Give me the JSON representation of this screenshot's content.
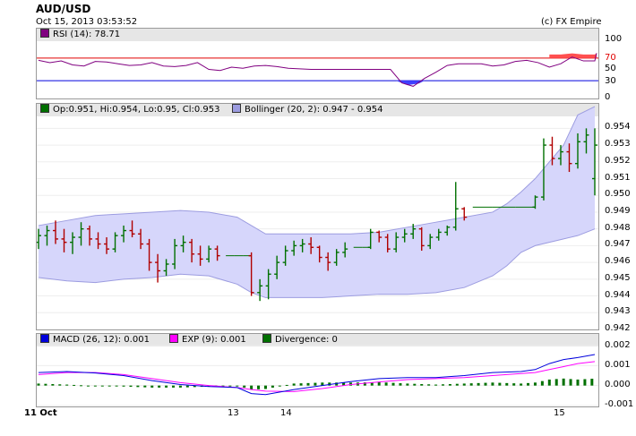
{
  "header": {
    "title": "AUD/USD",
    "timestamp": "Oct 15, 2013 03:53:52",
    "copyright": "(c) FX Empire"
  },
  "colors": {
    "bull": "#007000",
    "bear": "#b00000",
    "band_fill": "#d6d6fb",
    "band_line": "#9c9ce0",
    "rsi_line": "#800080",
    "rsi_upper": "#e00000",
    "rsi_lower": "#0000dd",
    "macd": "#0000dd",
    "exp": "#ff00ff",
    "divergence": "#007000"
  },
  "chart_data": [
    {
      "type": "line",
      "panel": "rsi",
      "legend": "RSI (14): 78.71",
      "ylim": [
        0,
        100
      ],
      "y_ticks": [
        "100",
        "70",
        "50",
        "30",
        "0"
      ],
      "levels": [
        70,
        30
      ],
      "x": [
        0,
        4,
        8,
        12,
        16,
        20,
        24,
        28,
        32,
        36,
        40,
        44,
        48,
        52,
        56,
        60,
        64,
        68,
        72,
        76,
        80,
        84,
        88,
        92,
        96,
        100,
        104,
        108,
        112,
        116,
        120,
        124,
        128,
        132,
        136,
        140,
        144,
        148,
        152,
        156,
        160,
        164,
        168,
        172,
        176,
        180,
        184,
        188,
        192,
        196
      ],
      "values": [
        66,
        62,
        65,
        58,
        56,
        64,
        63,
        60,
        57,
        58,
        62,
        56,
        55,
        57,
        62,
        50,
        48,
        54,
        52,
        56,
        57,
        55,
        52,
        51,
        50,
        50,
        50,
        50,
        50,
        50,
        50,
        50,
        26,
        20,
        34,
        45,
        57,
        60,
        60,
        60,
        56,
        58,
        64,
        66,
        62,
        54,
        60,
        72,
        65,
        65
      ],
      "last": 78.71
    },
    {
      "type": "candlestick",
      "panel": "price",
      "legend_ohlc": "Op:0.951, Hi:0.954, Lo:0.95, Cl:0.953",
      "legend_bands": "Bollinger (20, 2): 0.947 - 0.954",
      "ylim": [
        0.942,
        0.9545
      ],
      "y_ticks": [
        "0.954",
        "0.953",
        "0.952",
        "0.951",
        "0.950",
        "0.949",
        "0.948",
        "0.947",
        "0.946",
        "0.945",
        "0.944",
        "0.943",
        "0.942"
      ],
      "x_ticks": [
        "11 Oct",
        "13",
        "14",
        "15"
      ],
      "bands_x": [
        0,
        10,
        20,
        30,
        40,
        50,
        60,
        70,
        75,
        80,
        85,
        90,
        95,
        100,
        110,
        120,
        130,
        140,
        150,
        160,
        165,
        170,
        175,
        180,
        185,
        190,
        196
      ],
      "bands_upper": [
        0.9482,
        0.9485,
        0.9488,
        0.9489,
        0.949,
        0.9491,
        0.949,
        0.9487,
        0.9482,
        0.9477,
        0.9477,
        0.9477,
        0.9477,
        0.9477,
        0.9477,
        0.9478,
        0.9481,
        0.9484,
        0.9487,
        0.949,
        0.9495,
        0.9502,
        0.951,
        0.952,
        0.953,
        0.9548,
        0.9553
      ],
      "bands_lower": [
        0.9451,
        0.9449,
        0.9448,
        0.945,
        0.9451,
        0.9453,
        0.9452,
        0.9447,
        0.9442,
        0.9439,
        0.9439,
        0.9439,
        0.9439,
        0.9439,
        0.944,
        0.9441,
        0.9441,
        0.9442,
        0.9445,
        0.9452,
        0.9458,
        0.9466,
        0.947,
        0.9472,
        0.9474,
        0.9476,
        0.948
      ],
      "candles": [
        {
          "x": 0,
          "o": 0.9472,
          "h": 0.948,
          "l": 0.9468,
          "c": 0.9476
        },
        {
          "x": 3,
          "o": 0.9476,
          "h": 0.9482,
          "l": 0.947,
          "c": 0.9479
        },
        {
          "x": 6,
          "o": 0.9479,
          "h": 0.9485,
          "l": 0.9471,
          "c": 0.9474
        },
        {
          "x": 9,
          "o": 0.9474,
          "h": 0.948,
          "l": 0.9466,
          "c": 0.9472
        },
        {
          "x": 12,
          "o": 0.9472,
          "h": 0.9478,
          "l": 0.9465,
          "c": 0.9475
        },
        {
          "x": 15,
          "o": 0.9475,
          "h": 0.9484,
          "l": 0.947,
          "c": 0.948
        },
        {
          "x": 18,
          "o": 0.948,
          "h": 0.9482,
          "l": 0.947,
          "c": 0.9474
        },
        {
          "x": 21,
          "o": 0.9474,
          "h": 0.9478,
          "l": 0.9468,
          "c": 0.9471
        },
        {
          "x": 24,
          "o": 0.9471,
          "h": 0.9475,
          "l": 0.9465,
          "c": 0.9468
        },
        {
          "x": 27,
          "o": 0.9468,
          "h": 0.9478,
          "l": 0.9466,
          "c": 0.9476
        },
        {
          "x": 30,
          "o": 0.9476,
          "h": 0.9482,
          "l": 0.9472,
          "c": 0.9479
        },
        {
          "x": 33,
          "o": 0.9479,
          "h": 0.9485,
          "l": 0.9475,
          "c": 0.9477
        },
        {
          "x": 36,
          "o": 0.9477,
          "h": 0.948,
          "l": 0.9468,
          "c": 0.9471
        },
        {
          "x": 39,
          "o": 0.9471,
          "h": 0.9474,
          "l": 0.9455,
          "c": 0.946
        },
        {
          "x": 42,
          "o": 0.946,
          "h": 0.9465,
          "l": 0.9448,
          "c": 0.9455
        },
        {
          "x": 45,
          "o": 0.9455,
          "h": 0.9462,
          "l": 0.9452,
          "c": 0.9459
        },
        {
          "x": 48,
          "o": 0.9459,
          "h": 0.9474,
          "l": 0.9456,
          "c": 0.947
        },
        {
          "x": 51,
          "o": 0.947,
          "h": 0.9476,
          "l": 0.9466,
          "c": 0.9472
        },
        {
          "x": 54,
          "o": 0.9472,
          "h": 0.9474,
          "l": 0.946,
          "c": 0.9465
        },
        {
          "x": 57,
          "o": 0.9465,
          "h": 0.947,
          "l": 0.9458,
          "c": 0.9462
        },
        {
          "x": 60,
          "o": 0.9462,
          "h": 0.947,
          "l": 0.946,
          "c": 0.9468
        },
        {
          "x": 63,
          "o": 0.9468,
          "h": 0.947,
          "l": 0.9461,
          "c": 0.9464
        },
        {
          "x": 66,
          "o": 0.9464,
          "h": 0.9465,
          "l": 0.9463,
          "c": 0.9464
        },
        {
          "x": 69,
          "o": 0.9464,
          "h": 0.9465,
          "l": 0.9463,
          "c": 0.9464
        },
        {
          "x": 72,
          "o": 0.9464,
          "h": 0.9465,
          "l": 0.9463,
          "c": 0.9464
        },
        {
          "x": 75,
          "o": 0.9464,
          "h": 0.9466,
          "l": 0.944,
          "c": 0.9442
        },
        {
          "x": 78,
          "o": 0.9442,
          "h": 0.945,
          "l": 0.9437,
          "c": 0.9446
        },
        {
          "x": 81,
          "o": 0.9446,
          "h": 0.9456,
          "l": 0.9438,
          "c": 0.9453
        },
        {
          "x": 84,
          "o": 0.9453,
          "h": 0.9464,
          "l": 0.945,
          "c": 0.946
        },
        {
          "x": 87,
          "o": 0.946,
          "h": 0.947,
          "l": 0.9458,
          "c": 0.9467
        },
        {
          "x": 90,
          "o": 0.9467,
          "h": 0.9473,
          "l": 0.9464,
          "c": 0.947
        },
        {
          "x": 93,
          "o": 0.947,
          "h": 0.9474,
          "l": 0.9466,
          "c": 0.9471
        },
        {
          "x": 96,
          "o": 0.9471,
          "h": 0.9475,
          "l": 0.9465,
          "c": 0.9469
        },
        {
          "x": 99,
          "o": 0.9469,
          "h": 0.947,
          "l": 0.946,
          "c": 0.9463
        },
        {
          "x": 102,
          "o": 0.9463,
          "h": 0.9466,
          "l": 0.9455,
          "c": 0.946
        },
        {
          "x": 105,
          "o": 0.946,
          "h": 0.9468,
          "l": 0.9458,
          "c": 0.9466
        },
        {
          "x": 108,
          "o": 0.9466,
          "h": 0.9472,
          "l": 0.9463,
          "c": 0.9468
        },
        {
          "x": 111,
          "o": 0.9468,
          "h": 0.947,
          "l": 0.9468,
          "c": 0.9469
        },
        {
          "x": 114,
          "o": 0.9469,
          "h": 0.947,
          "l": 0.9468,
          "c": 0.9469
        },
        {
          "x": 117,
          "o": 0.9469,
          "h": 0.948,
          "l": 0.9468,
          "c": 0.9478
        },
        {
          "x": 120,
          "o": 0.9478,
          "h": 0.9479,
          "l": 0.9472,
          "c": 0.9475
        },
        {
          "x": 123,
          "o": 0.9475,
          "h": 0.9477,
          "l": 0.9466,
          "c": 0.9468
        },
        {
          "x": 126,
          "o": 0.9468,
          "h": 0.9478,
          "l": 0.9466,
          "c": 0.9475
        },
        {
          "x": 129,
          "o": 0.9475,
          "h": 0.948,
          "l": 0.9472,
          "c": 0.9477
        },
        {
          "x": 132,
          "o": 0.9477,
          "h": 0.9483,
          "l": 0.9474,
          "c": 0.948
        },
        {
          "x": 135,
          "o": 0.948,
          "h": 0.9481,
          "l": 0.9467,
          "c": 0.947
        },
        {
          "x": 138,
          "o": 0.947,
          "h": 0.9477,
          "l": 0.9468,
          "c": 0.9475
        },
        {
          "x": 141,
          "o": 0.9475,
          "h": 0.948,
          "l": 0.9473,
          "c": 0.9478
        },
        {
          "x": 144,
          "o": 0.9478,
          "h": 0.9482,
          "l": 0.9476,
          "c": 0.9481
        },
        {
          "x": 147,
          "o": 0.9481,
          "h": 0.9508,
          "l": 0.9479,
          "c": 0.9492
        },
        {
          "x": 150,
          "o": 0.9492,
          "h": 0.9493,
          "l": 0.9485,
          "c": 0.9487
        },
        {
          "x": 153,
          "o": 0.9493,
          "h": 0.9494,
          "l": 0.9492,
          "c": 0.9493
        },
        {
          "x": 160,
          "o": 0.9493,
          "h": 0.9494,
          "l": 0.9492,
          "c": 0.9493
        },
        {
          "x": 168,
          "o": 0.9493,
          "h": 0.9494,
          "l": 0.9492,
          "c": 0.9493
        },
        {
          "x": 175,
          "o": 0.9493,
          "h": 0.95,
          "l": 0.9492,
          "c": 0.9499
        },
        {
          "x": 178,
          "o": 0.9499,
          "h": 0.9534,
          "l": 0.9497,
          "c": 0.953
        },
        {
          "x": 181,
          "o": 0.953,
          "h": 0.9535,
          "l": 0.9518,
          "c": 0.9522
        },
        {
          "x": 184,
          "o": 0.9522,
          "h": 0.953,
          "l": 0.9518,
          "c": 0.9526
        },
        {
          "x": 187,
          "o": 0.9526,
          "h": 0.9531,
          "l": 0.9514,
          "c": 0.9519
        },
        {
          "x": 190,
          "o": 0.9519,
          "h": 0.9537,
          "l": 0.9516,
          "c": 0.9532
        },
        {
          "x": 193,
          "o": 0.9532,
          "h": 0.954,
          "l": 0.9525,
          "c": 0.9536
        },
        {
          "x": 196,
          "o": 0.951,
          "h": 0.954,
          "l": 0.95,
          "c": 0.953
        }
      ]
    },
    {
      "type": "line",
      "panel": "macd",
      "legend_macd": "MACD (26, 12): 0.001",
      "legend_exp": "EXP (9): 0.001",
      "legend_div": "Divergence: 0",
      "ylim": [
        -0.001,
        0.002
      ],
      "y_ticks": [
        "0.002",
        "0.001",
        "0.000",
        "-0.001"
      ],
      "x": [
        0,
        10,
        20,
        30,
        40,
        50,
        60,
        70,
        75,
        80,
        90,
        100,
        110,
        120,
        130,
        140,
        150,
        160,
        170,
        175,
        180,
        185,
        190,
        196
      ],
      "macd": [
        0.00065,
        0.0007,
        0.00063,
        0.0005,
        0.00025,
        5e-05,
        -5e-05,
        -0.0001,
        -0.0004,
        -0.00045,
        -0.0002,
        0.0,
        0.0002,
        0.00035,
        0.0004,
        0.0004,
        0.0005,
        0.00065,
        0.0007,
        0.0008,
        0.0011,
        0.0013,
        0.0014,
        0.00155
      ],
      "exp": [
        0.00055,
        0.00065,
        0.00065,
        0.00055,
        0.00035,
        0.00015,
        0.0,
        -0.0001,
        -0.0002,
        -0.00028,
        -0.0003,
        -0.00015,
        5e-05,
        0.00018,
        0.0003,
        0.00035,
        0.0004,
        0.0005,
        0.0006,
        0.00065,
        0.0008,
        0.00095,
        0.0011,
        0.0012
      ],
      "divergence": [
        0.0001,
        5e-05,
        -2e-05,
        -5e-05,
        -0.0001,
        -0.0001,
        -5e-05,
        0.0,
        -0.0002,
        -0.00017,
        0.0001,
        0.00015,
        0.00015,
        0.00017,
        0.0001,
        5e-05,
        0.0001,
        0.00015,
        0.0001,
        0.00015,
        0.0003,
        0.00035,
        0.0003,
        0.00035
      ]
    }
  ]
}
